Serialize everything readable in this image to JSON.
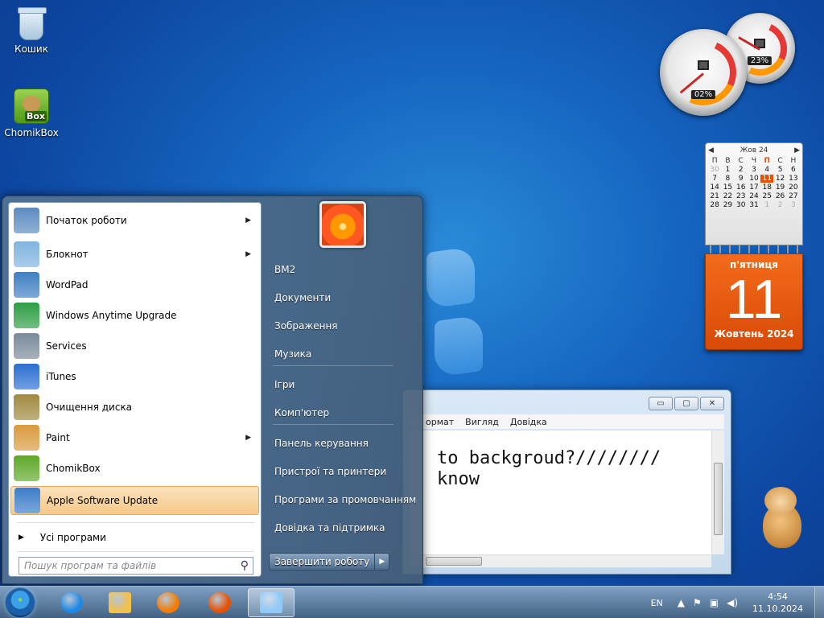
{
  "desktop": {
    "icons": [
      {
        "label": "Кошик",
        "icon": "recycle-bin-icon"
      },
      {
        "label": "ChomikBox",
        "icon": "chomikbox-icon",
        "badge": "Box"
      }
    ]
  },
  "gadgets": {
    "cpu_meter": {
      "cpu_percent": "02%",
      "memory_percent": "23%"
    },
    "calendar": {
      "month_label": "Жов 24",
      "weekdays": [
        "П",
        "В",
        "С",
        "Ч",
        "П",
        "С",
        "Н"
      ],
      "highlight_weekday_index": 4,
      "days": [
        [
          "30",
          "1",
          "2",
          "3",
          "4",
          "5",
          "6"
        ],
        [
          "7",
          "8",
          "9",
          "10",
          "11",
          "12",
          "13"
        ],
        [
          "14",
          "15",
          "16",
          "17",
          "18",
          "19",
          "20"
        ],
        [
          "21",
          "22",
          "23",
          "24",
          "25",
          "26",
          "27"
        ],
        [
          "28",
          "29",
          "30",
          "31",
          "1",
          "2",
          "3"
        ]
      ],
      "today": "11",
      "weekday_name": "п'ятниця",
      "big_day": "11",
      "month_year": "Жовтень 2024"
    }
  },
  "notepad": {
    "menu": [
      "ормат",
      "Вигляд",
      "Довідка"
    ],
    "text_lines": [
      "to backgroud?////////",
      "know"
    ],
    "controls": {
      "minimize": "▭",
      "maximize": "▢",
      "close": "✕"
    }
  },
  "start_menu": {
    "left_items": [
      {
        "label": "Початок роботи",
        "has_submenu": true,
        "icon": "getting-started-icon",
        "color": "#5b8bc0"
      },
      {
        "label": "Блокнот",
        "has_submenu": true,
        "icon": "notepad-icon",
        "color": "#7fb4e0"
      },
      {
        "label": "WordPad",
        "has_submenu": false,
        "icon": "wordpad-icon",
        "color": "#3f7fc2"
      },
      {
        "label": "Windows Anytime Upgrade",
        "has_submenu": false,
        "icon": "windows-flag-icon",
        "color": "#2e9d45"
      },
      {
        "label": "Services",
        "has_submenu": false,
        "icon": "services-gear-icon",
        "color": "#7a8a9a"
      },
      {
        "label": "iTunes",
        "has_submenu": false,
        "icon": "itunes-icon",
        "color": "#2b6fd1"
      },
      {
        "label": "Очищення диска",
        "has_submenu": false,
        "icon": "disk-cleanup-icon",
        "color": "#a08a40"
      },
      {
        "label": "Paint",
        "has_submenu": true,
        "icon": "paint-icon",
        "color": "#d99a3e"
      },
      {
        "label": "ChomikBox",
        "has_submenu": false,
        "icon": "chomikbox-icon",
        "color": "#5fa82a"
      },
      {
        "label": "Apple Software Update",
        "has_submenu": false,
        "icon": "apple-update-icon",
        "color": "#3d7cc9",
        "highlighted": true
      }
    ],
    "all_programs": "Усі програми",
    "search_placeholder": "Пошук програм та файлів",
    "right_items": [
      "BM2",
      "Документи",
      "Зображення",
      "Музика",
      "Ігри",
      "Комп'ютер",
      "Панель керування",
      "Пристрої та принтери",
      "Програми за промовчанням",
      "Довідка та підтримка"
    ],
    "shutdown_label": "Завершити роботу"
  },
  "taskbar": {
    "pinned": [
      {
        "name": "internet-explorer-icon",
        "color": "#1e88e5"
      },
      {
        "name": "explorer-folder-icon",
        "color": "#f2c14e"
      },
      {
        "name": "media-player-icon",
        "color": "#f57c00"
      },
      {
        "name": "firefox-icon",
        "color": "#e65100"
      },
      {
        "name": "notepad-icon",
        "color": "#90caf9",
        "active": true
      }
    ],
    "language": "EN",
    "time": "4:54",
    "date": "11.10.2024"
  }
}
